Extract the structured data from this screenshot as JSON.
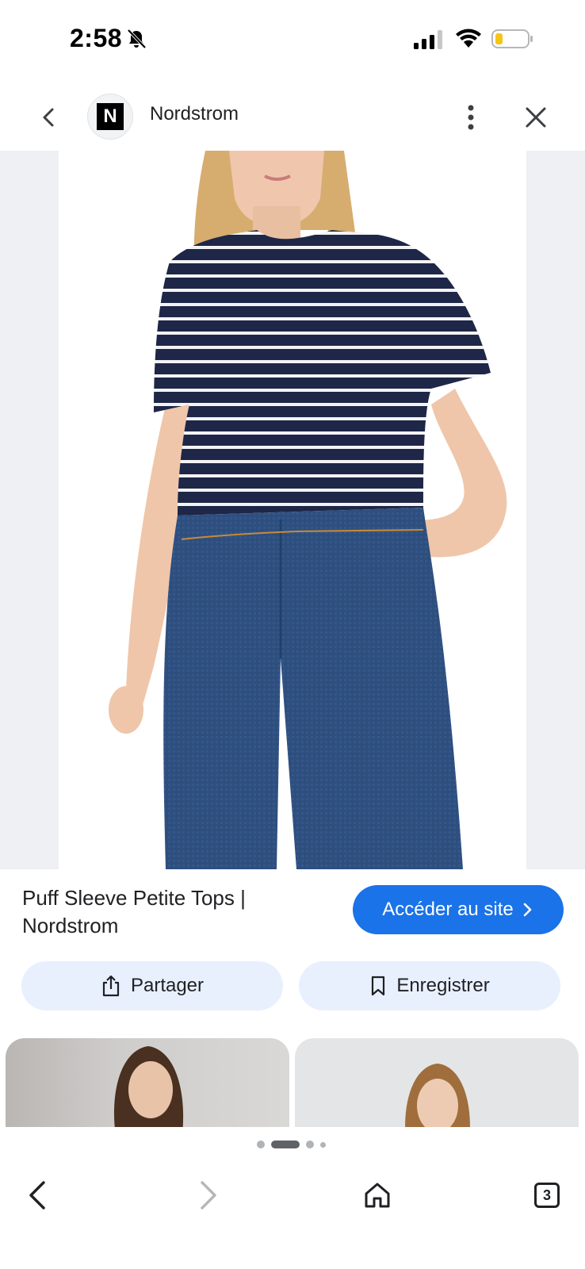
{
  "status_bar": {
    "time": "2:58",
    "icons": [
      "bell-off-icon",
      "signal-icon",
      "wifi-icon",
      "battery-icon"
    ],
    "battery_level": 0.2
  },
  "header": {
    "site_logo_letter": "N",
    "site_name": "Nordstrom",
    "icons": [
      "back-icon",
      "more-vert-icon",
      "close-icon"
    ]
  },
  "product": {
    "title": "Puff Sleeve Petite Tops | Nordstrom",
    "visit_label": "Accéder au site",
    "share_label": "Partager",
    "save_label": "Enregistrer"
  },
  "pager": {
    "count": 4,
    "active_index": 1
  },
  "bottom_nav": {
    "tab_count": "3",
    "icons": [
      "nav-back-icon",
      "nav-forward-icon",
      "home-icon",
      "tabs-icon"
    ]
  },
  "colors": {
    "accent": "#1a73e8",
    "chip_bg": "#e8f0fe",
    "shirt_navy": "#1e2747",
    "denim": "#2e4f7e"
  }
}
